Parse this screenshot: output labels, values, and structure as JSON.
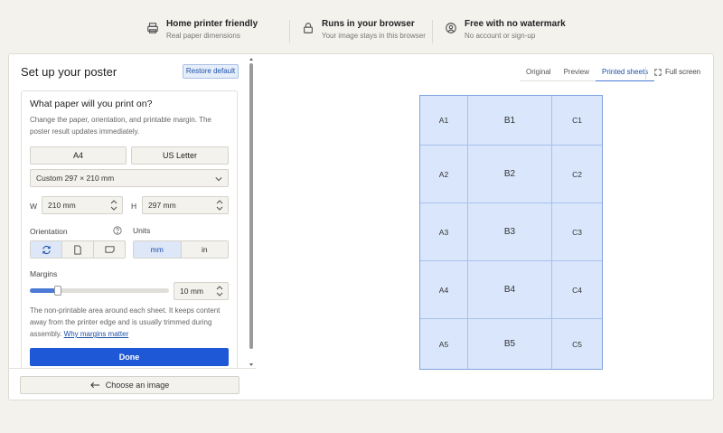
{
  "features": [
    {
      "icon": "printer-icon",
      "title": "Home printer friendly",
      "subtitle": "Real paper dimensions"
    },
    {
      "icon": "lock-icon",
      "title": "Runs in your browser",
      "subtitle": "Your image stays in this browser"
    },
    {
      "icon": "user-circle-icon",
      "title": "Free with no watermark",
      "subtitle": "No account or sign-up"
    }
  ],
  "panel": {
    "title": "Set up your poster",
    "restore_label": "Restore default",
    "question": "What paper will you print on?",
    "description": "Change the paper, orientation, and printable margin. The poster result updates immediately.",
    "paper_buttons": [
      "A4",
      "US Letter"
    ],
    "paper_select": "Custom 297 × 210 mm",
    "width_label": "W",
    "width_value": "210 mm",
    "height_label": "H",
    "height_value": "297 mm",
    "orientation_label": "Orientation",
    "units_label": "Units",
    "units": [
      "mm",
      "in"
    ],
    "units_selected": "mm",
    "margins_label": "Margins",
    "margin_value": "10 mm",
    "margin_slider_fraction": 0.2,
    "margin_note": "The non-printable area around each sheet. It keeps content away from the printer edge and is usually trimmed during assembly.",
    "margin_link": "Why margins matter",
    "done_label": "Done",
    "choose_image_label": "Choose an image"
  },
  "view": {
    "tabs": [
      "Original",
      "Preview",
      "Printed sheets"
    ],
    "active_tab": "Printed sheets",
    "fullscreen_label": "Full screen"
  },
  "sheets": {
    "columns": [
      "A",
      "B",
      "C"
    ],
    "rows": [
      1,
      2,
      3,
      4,
      5
    ],
    "labels": [
      [
        "A1",
        "B1",
        "C1"
      ],
      [
        "A2",
        "B2",
        "C2"
      ],
      [
        "A3",
        "B3",
        "C3"
      ],
      [
        "A4",
        "B4",
        "C4"
      ],
      [
        "A5",
        "B5",
        "C5"
      ]
    ]
  },
  "colors": {
    "accent": "#1f58d6",
    "sheet_fill": "#d9e6fb",
    "sheet_border": "#7ea2e0"
  }
}
